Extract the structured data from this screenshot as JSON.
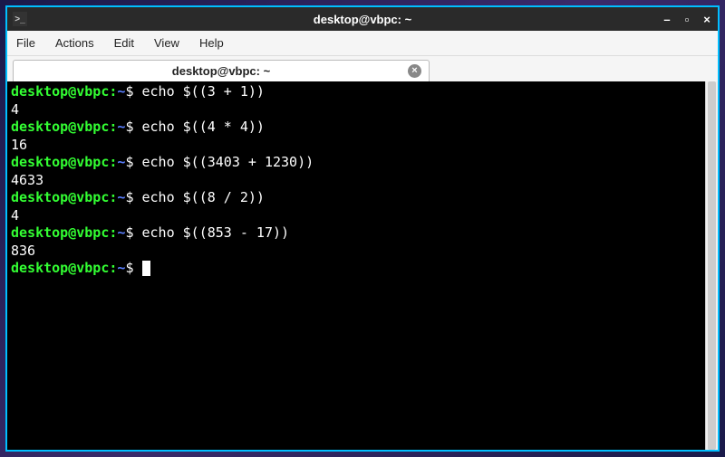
{
  "titlebar": {
    "title": "desktop@vbpc: ~",
    "minimize": "–",
    "maximize": "▫",
    "close": "×"
  },
  "menubar": {
    "file": "File",
    "actions": "Actions",
    "edit": "Edit",
    "view": "View",
    "help": "Help"
  },
  "tab": {
    "label": "desktop@vbpc: ~",
    "close": "×"
  },
  "prompt": {
    "user_host": "desktop@vbpc",
    "colon": ":",
    "path": "~",
    "symbol": "$"
  },
  "terminal": {
    "lines": [
      {
        "type": "cmd",
        "command": "echo $((3 + 1))"
      },
      {
        "type": "out",
        "text": "4"
      },
      {
        "type": "cmd",
        "command": "echo $((4 * 4))"
      },
      {
        "type": "out",
        "text": "16"
      },
      {
        "type": "cmd",
        "command": "echo $((3403 + 1230))"
      },
      {
        "type": "out",
        "text": "4633"
      },
      {
        "type": "cmd",
        "command": "echo $((8 / 2))"
      },
      {
        "type": "out",
        "text": "4"
      },
      {
        "type": "cmd",
        "command": "echo $((853 - 17))"
      },
      {
        "type": "out",
        "text": "836"
      },
      {
        "type": "prompt_cursor"
      }
    ]
  }
}
